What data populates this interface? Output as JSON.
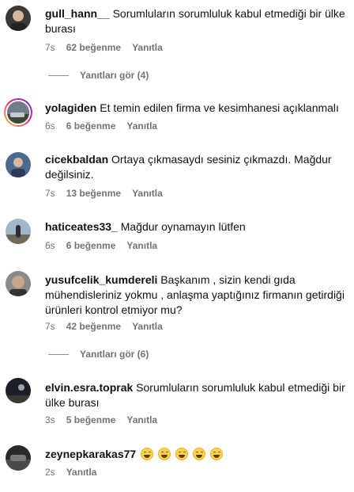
{
  "comments": [
    {
      "username": "gull_hann__",
      "text": "Sorumluların sorumluluk kabul etmediği bir ülke burası",
      "time": "7s",
      "likes": "62 beğenme",
      "reply": "Yanıtla",
      "replies_label": "Yanıtları gör (4)"
    },
    {
      "username": "yolagiden",
      "text": "Et temin edilen firma ve kesimhanesi açıklanmalı",
      "time": "6s",
      "likes": "6 beğenme",
      "reply": "Yanıtla"
    },
    {
      "username": "cicekbaldan",
      "text": "Ortaya çıkmasaydı sesiniz çıkmazdı. Mağdur değilsiniz.",
      "time": "7s",
      "likes": "13 beğenme",
      "reply": "Yanıtla"
    },
    {
      "username": "haticeates33_",
      "text": "Mağdur oynamayın lütfen",
      "time": "6s",
      "likes": "6 beğenme",
      "reply": "Yanıtla"
    },
    {
      "username": "yusufcelik_kumdereli",
      "text": "Başkanım , sizin kendi gıda mühendisleriniz yokmu , anlaşma yaptığınız firmanın getirdiği ürünleri kontrol etmiyor mu?",
      "time": "7s",
      "likes": "42 beğenme",
      "reply": "Yanıtla",
      "replies_label": "Yanıtları gör (6)"
    },
    {
      "username": "elvin.esra.toprak",
      "text": "Sorumluların sorumluluk kabul etmediği bir ülke burası",
      "time": "3s",
      "likes": "5 beğenme",
      "reply": "Yanıtla"
    },
    {
      "username": "zeynepkarakas77",
      "text": "",
      "time": "2s",
      "reply": "Yanıtla",
      "emoji": "😂😂😂😂😂"
    }
  ]
}
